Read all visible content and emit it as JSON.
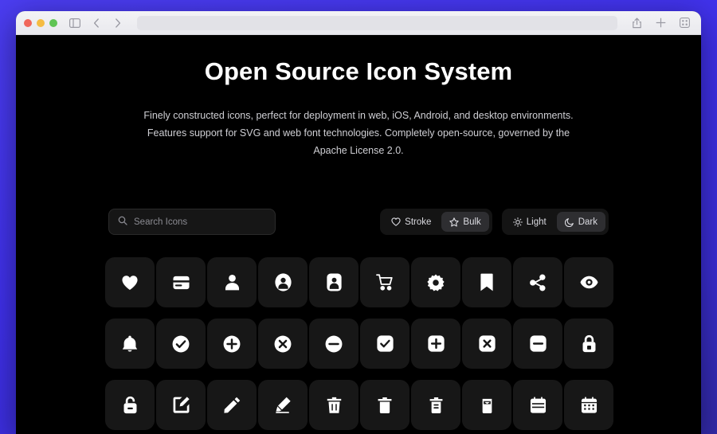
{
  "browser": {
    "traffic_lights": [
      "close",
      "minimize",
      "maximize"
    ],
    "sidebar_toggle": "sidebar-toggle-icon",
    "back": "back-chevron-icon",
    "forward": "forward-chevron-icon",
    "address_value": "",
    "address_placeholder": "",
    "share": "share-icon",
    "new_tab": "plus-icon",
    "tab_overview": "tab-grid-icon"
  },
  "hero": {
    "title": "Open Source Icon System",
    "subtitle": "Finely constructed icons, perfect for deployment in web, iOS, Android, and desktop environments. Features support for SVG and web font technologies. Completely open-source, governed by the Apache License 2.0."
  },
  "search": {
    "placeholder": "Search Icons",
    "value": "",
    "icon": "search-icon"
  },
  "style_toggle": {
    "options": [
      {
        "label": "Stroke",
        "icon": "heart-outline-icon",
        "active": false
      },
      {
        "label": "Bulk",
        "icon": "star-outline-icon",
        "active": true
      }
    ]
  },
  "theme_toggle": {
    "options": [
      {
        "label": "Light",
        "icon": "sun-icon",
        "active": false
      },
      {
        "label": "Dark",
        "icon": "moon-icon",
        "active": true
      }
    ]
  },
  "colors": {
    "desktop_background": "#3f30ea",
    "page_background": "#000000",
    "tile_background": "#171717",
    "accent_text": "#ffffff",
    "muted_text": "#cfcfd4"
  },
  "icons": [
    {
      "name": "heart"
    },
    {
      "name": "card"
    },
    {
      "name": "person"
    },
    {
      "name": "person-circle"
    },
    {
      "name": "person-square"
    },
    {
      "name": "cart"
    },
    {
      "name": "gear"
    },
    {
      "name": "bookmark"
    },
    {
      "name": "share"
    },
    {
      "name": "eye"
    },
    {
      "name": "bell"
    },
    {
      "name": "check-circle"
    },
    {
      "name": "plus-circle"
    },
    {
      "name": "x-circle"
    },
    {
      "name": "minus-circle"
    },
    {
      "name": "check-square"
    },
    {
      "name": "plus-square"
    },
    {
      "name": "x-square"
    },
    {
      "name": "minus-square"
    },
    {
      "name": "lock"
    },
    {
      "name": "unlock"
    },
    {
      "name": "edit-square"
    },
    {
      "name": "pencil"
    },
    {
      "name": "highlighter"
    },
    {
      "name": "trash"
    },
    {
      "name": "trash-alt"
    },
    {
      "name": "trash-bin"
    },
    {
      "name": "trash-lid"
    },
    {
      "name": "calendar"
    },
    {
      "name": "calendar-days"
    }
  ]
}
